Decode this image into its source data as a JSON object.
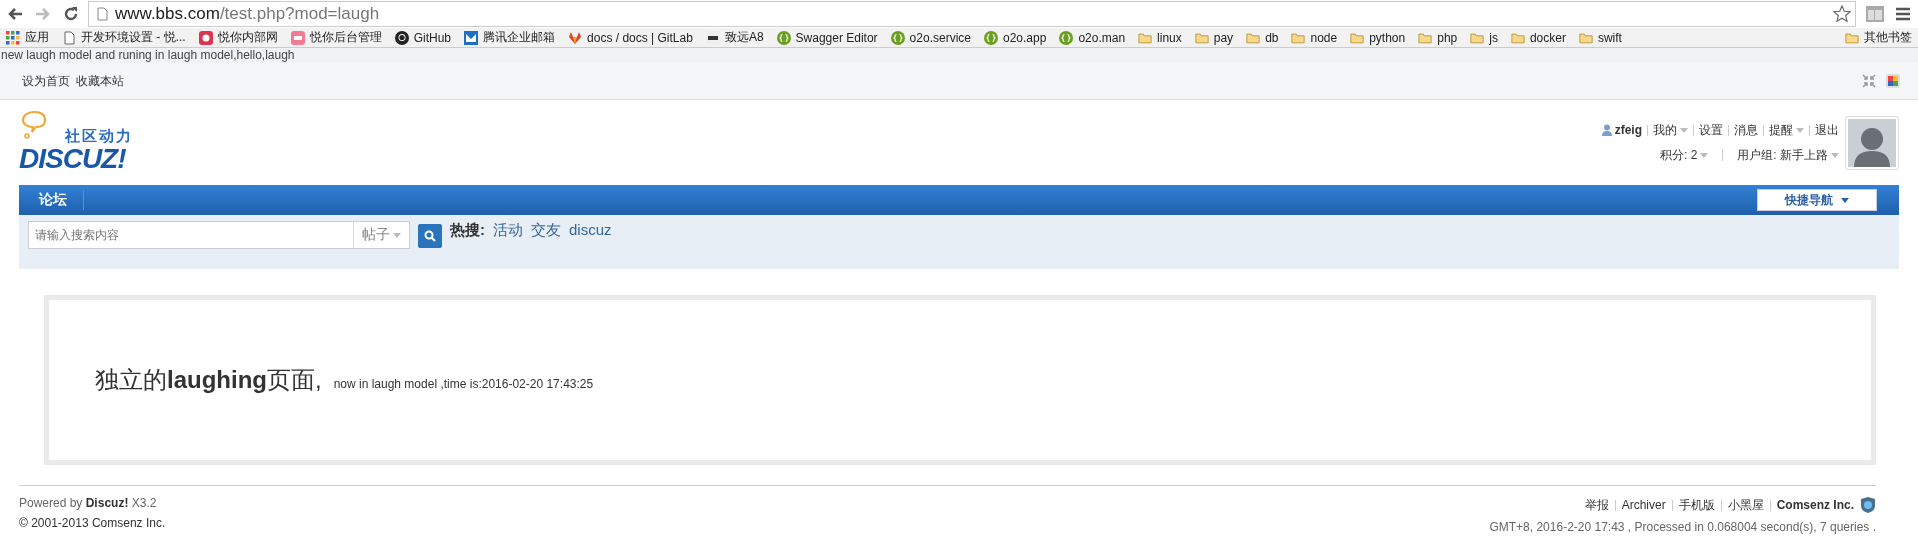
{
  "browser": {
    "address": {
      "host": "www.bbs.com",
      "path": "/test.php?mod=laugh"
    },
    "bookmarks": [
      {
        "label": "应用",
        "kind": "apps"
      },
      {
        "label": "开发环境设置 - 悦...",
        "kind": "page"
      },
      {
        "label": "悦你内部网",
        "kind": "app"
      },
      {
        "label": "悦你后台管理",
        "kind": "app"
      },
      {
        "label": "GitHub",
        "kind": "site"
      },
      {
        "label": "腾讯企业邮箱",
        "kind": "site"
      },
      {
        "label": "docs / docs | GitLab",
        "kind": "site"
      },
      {
        "label": "致远A8",
        "kind": "site"
      },
      {
        "label": "Swagger Editor",
        "kind": "swagger"
      },
      {
        "label": "o2o.service",
        "kind": "swagger"
      },
      {
        "label": "o2o.app",
        "kind": "swagger"
      },
      {
        "label": "o2o.man",
        "kind": "swagger"
      },
      {
        "label": "linux",
        "kind": "folder"
      },
      {
        "label": "pay",
        "kind": "folder"
      },
      {
        "label": "db",
        "kind": "folder"
      },
      {
        "label": "node",
        "kind": "folder"
      },
      {
        "label": "python",
        "kind": "folder"
      },
      {
        "label": "php",
        "kind": "folder"
      },
      {
        "label": "js",
        "kind": "folder"
      },
      {
        "label": "docker",
        "kind": "folder"
      },
      {
        "label": "swift",
        "kind": "folder"
      }
    ],
    "other_bookmarks": "其他书签"
  },
  "debug_output": "new laugh model and runing in laugh model,hello,laugh",
  "topbar": {
    "links": [
      "设为首页",
      "收藏本站"
    ]
  },
  "header": {
    "logo": {
      "tagline": "社区动力",
      "wordmark": "DISCUZ!"
    },
    "user": {
      "name": "zfeig",
      "menu": [
        {
          "label": "我的",
          "dropdown": true
        },
        {
          "label": "设置",
          "dropdown": false
        },
        {
          "label": "消息",
          "dropdown": false
        },
        {
          "label": "提醒",
          "dropdown": true
        },
        {
          "label": "退出",
          "dropdown": false
        }
      ],
      "credits": "积分: 2",
      "group": "用户组: 新手上路"
    }
  },
  "nav": {
    "items": [
      {
        "label": "论坛",
        "selected": true
      }
    ],
    "quick_nav": "快捷导航"
  },
  "search": {
    "placeholder": "请输入搜索内容",
    "scope": "帖子",
    "hot_label": "热搜:",
    "hot": [
      "活动",
      "交友",
      "discuz"
    ]
  },
  "content": {
    "heading": "独立的**laughing**页面,",
    "note": "now in laugh model ,time is:2016-02-20 17:43:25"
  },
  "footer": {
    "powered": "Powered by **Discuz!** X3.2",
    "copyright": "© 2001-2013 Comsenz Inc.",
    "links": [
      "举报",
      "Archiver",
      "手机版",
      "小黑屋"
    ],
    "company": "Comsenz Inc.",
    "status": "GMT+8, 2016-2-20 17:43 , Processed in 0.068004 second(s), 7 queries ."
  }
}
